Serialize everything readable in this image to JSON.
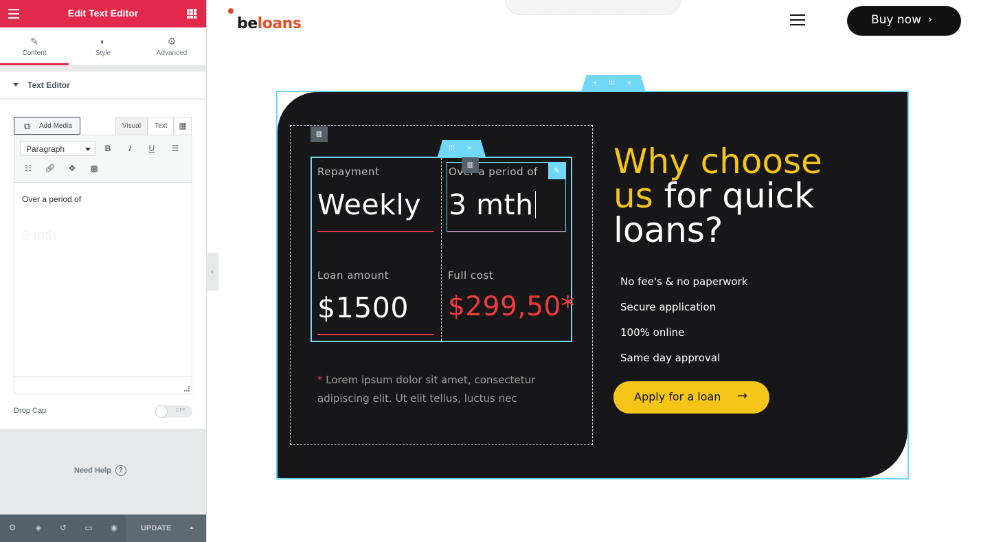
{
  "panel": {
    "title": "Edit Text Editor",
    "tabs": [
      {
        "label": "Content",
        "icon": "pencil-icon"
      },
      {
        "label": "Style",
        "icon": "half-circle-icon"
      },
      {
        "label": "Advanced",
        "icon": "gear-icon"
      }
    ],
    "section_title": "Text Editor",
    "add_media_label": "Add Media",
    "editor_tabs": {
      "visual": "Visual",
      "text": "Text"
    },
    "format_select": "Paragraph",
    "toolbar_glyphs": {
      "bold": "B",
      "italic": "I",
      "underline": "U"
    },
    "editor_lines": [
      "Over a period of",
      "3 mth"
    ],
    "drop_cap_label": "Drop Cap",
    "drop_cap_state": "OFF",
    "need_help": "Need Help",
    "update_label": "UPDATE",
    "accent_color": "#e2294c"
  },
  "site": {
    "logo_part1": "be",
    "logo_part2": "loans",
    "buy_label": "Buy now",
    "stats": [
      {
        "label": "Repayment",
        "value": "Weekly"
      },
      {
        "label": "Over a period of",
        "value": "3 mth"
      },
      {
        "label": "Loan amount",
        "value": "$1500"
      },
      {
        "label": "Full cost",
        "value": "$299,50*"
      }
    ],
    "footnote_mark": "*",
    "footnote": "Lorem ipsum dolor sit amet, consectetur adipiscing elit. Ut elit tellus, luctus nec",
    "headline": {
      "part1": "Why choose",
      "part2": "us",
      "part3": "for quick",
      "part4": "loans?"
    },
    "features": [
      "No fee's & no paperwork",
      "Secure application",
      "100% online",
      "Same day approval"
    ],
    "apply_label": "Apply for a loan",
    "colors": {
      "yellow": "#f5c518",
      "red": "#ef3b3b",
      "dark": "#171719",
      "selection": "#71d7f7"
    }
  }
}
